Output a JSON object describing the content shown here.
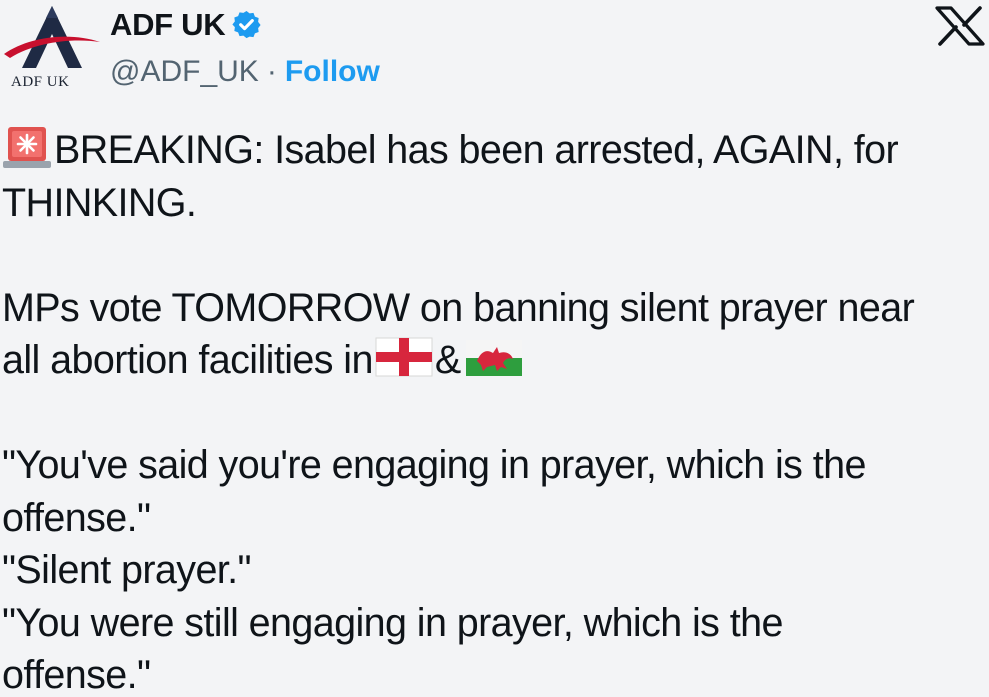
{
  "header": {
    "avatar_caption": "ADF UK",
    "display_name": "ADF UK",
    "handle": "@ADF_UK",
    "separator": "·",
    "follow_label": "Follow",
    "close_icon": "x-logo-icon"
  },
  "tweet": {
    "line1_text": "BREAKING: Isabel has been arrested, AGAIN, for",
    "line2_text": "THINKING.",
    "line3_text": "MPs vote TOMORROW on banning silent prayer near",
    "line4_text": "all abortion facilities in",
    "line4_amp": "&",
    "quote1_line1": "\"You've said you're engaging in prayer, which is the",
    "quote1_line2": "offense.\"",
    "quote2": "\"Silent prayer.\"",
    "quote3_line1": "\"You were still engaging in prayer, which is the",
    "quote3_line2": "offense.\"",
    "icons": [
      "siren-icon",
      "england-flag-icon",
      "wales-flag-icon",
      "verified-badge-icon"
    ]
  },
  "colors": {
    "background": "#f3f4f6",
    "text": "#0f1419",
    "secondary_text": "#536471",
    "accent": "#1d9bf0",
    "logo_red": "#c8102e",
    "logo_navy": "#1f2a44"
  }
}
